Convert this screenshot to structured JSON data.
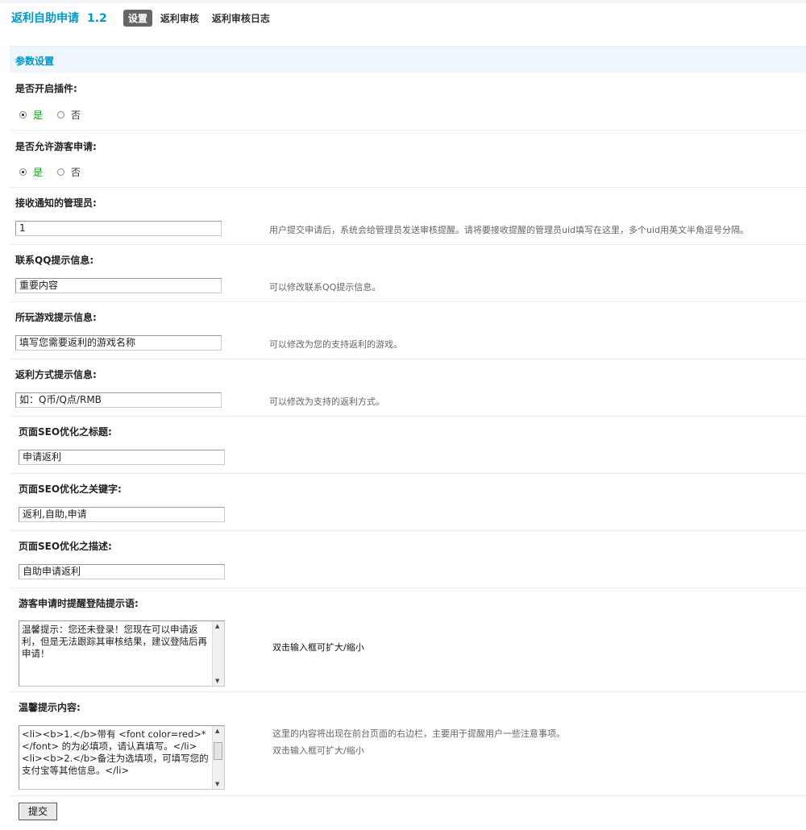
{
  "header": {
    "app_title": "返利自助申请",
    "version": "1.2",
    "tabs": [
      {
        "label": "设置",
        "active": true
      },
      {
        "label": "返利审核",
        "active": false
      },
      {
        "label": "返利审核日志",
        "active": false
      }
    ]
  },
  "section": {
    "title": "参数设置"
  },
  "settings": {
    "enable_plugin": {
      "label": "是否开启插件:",
      "yes": "是",
      "no": "否",
      "selected": "是"
    },
    "allow_guest": {
      "label": "是否允许游客申请:",
      "yes": "是",
      "no": "否",
      "selected": "是"
    },
    "notify_admin": {
      "label": "接收通知的管理员:",
      "value": "1",
      "hint": "用户提交申请后，系统会给管理员发送审核提醒。请将要接收提醒的管理员uid填写在这里，多个uid用英文半角逗号分隔。"
    },
    "qq_tip": {
      "label": "联系QQ提示信息:",
      "value": "重要内容",
      "hint": "可以修改联系QQ提示信息。"
    },
    "game_tip": {
      "label": "所玩游戏提示信息:",
      "value": "填写您需要返利的游戏名称",
      "hint": "可以修改为您的支持返利的游戏。"
    },
    "method_tip": {
      "label": "返利方式提示信息:",
      "value": "如：Q币/Q点/RMB",
      "hint": "可以修改为支持的返利方式。"
    },
    "seo_title": {
      "label": "页面SEO优化之标题:",
      "value": "申请返利"
    },
    "seo_keywords": {
      "label": "页面SEO优化之关键字:",
      "value": "返利,自助,申请"
    },
    "seo_description": {
      "label": "页面SEO优化之描述:",
      "value": "自助申请返利"
    },
    "guest_login_prompt": {
      "label": "游客申请时提醒登陆提示语:",
      "value": "温馨提示：您还未登录！您现在可以申请返利，但是无法跟踪其审核结果，建议登陆后再申请！",
      "hint": "双击输入框可扩大/缩小"
    },
    "warm_tip": {
      "label": "温馨提示内容:",
      "value": "<li><b>1.</b>带有 <font color=red>*</font> 的为必填项，请认真填写。</li>\n<li><b>2.</b>备注为选填项，可填写您的支付宝等其他信息。</li>",
      "hint1": "这里的内容将出现在前台页面的右边栏，主要用于提醒用户一些注意事项。",
      "hint2": "双击输入框可扩大/缩小"
    }
  },
  "submit_label": "提交",
  "colors": {
    "accent": "#0099cc",
    "yes_green": "#00aa00",
    "section_bg": "#f0f6fd"
  }
}
